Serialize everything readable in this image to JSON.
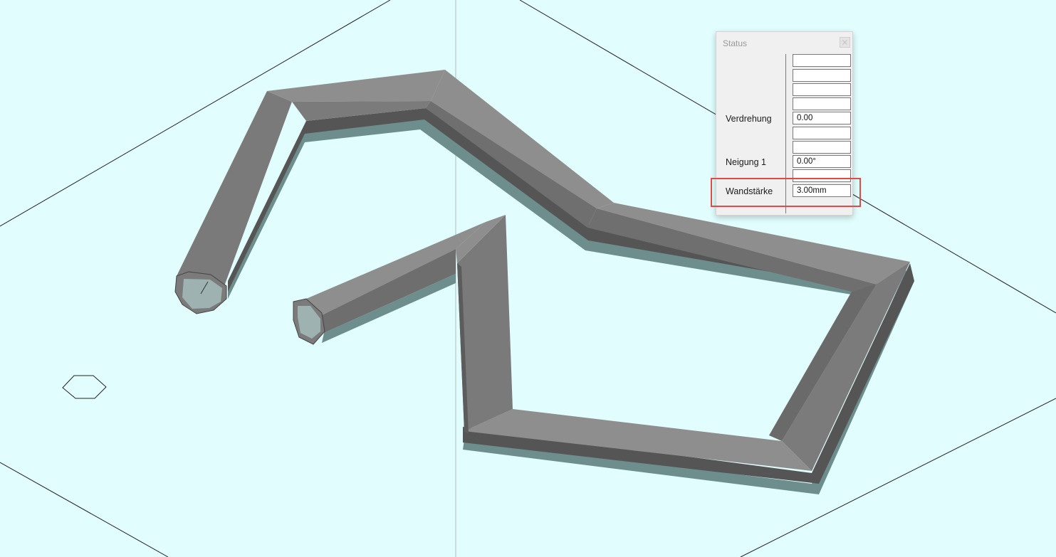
{
  "app": {
    "colors": {
      "floor": "#e1fdfd",
      "pipe_top": "#8e8e8e",
      "pipe_side": "#6e6e6e",
      "pipe_underside": "#6e8d8d",
      "pipe_interior": "#9fb2b2",
      "highlight": "#e24a4a"
    }
  },
  "status_panel": {
    "title": "Status",
    "close_icon": "close-icon",
    "fields": [
      {
        "label": "",
        "value": ""
      },
      {
        "label": "",
        "value": ""
      },
      {
        "label": "",
        "value": ""
      },
      {
        "label": "",
        "value": ""
      },
      {
        "label": "Verdrehung",
        "value": "0.00"
      },
      {
        "label": "",
        "value": ""
      },
      {
        "label": "",
        "value": ""
      },
      {
        "label": "Neigung 1",
        "value": "0.00°"
      },
      {
        "label": "",
        "value": ""
      },
      {
        "label": "Wandstärke",
        "value": "3.00mm"
      }
    ],
    "highlighted_field": "Wandstärke"
  }
}
